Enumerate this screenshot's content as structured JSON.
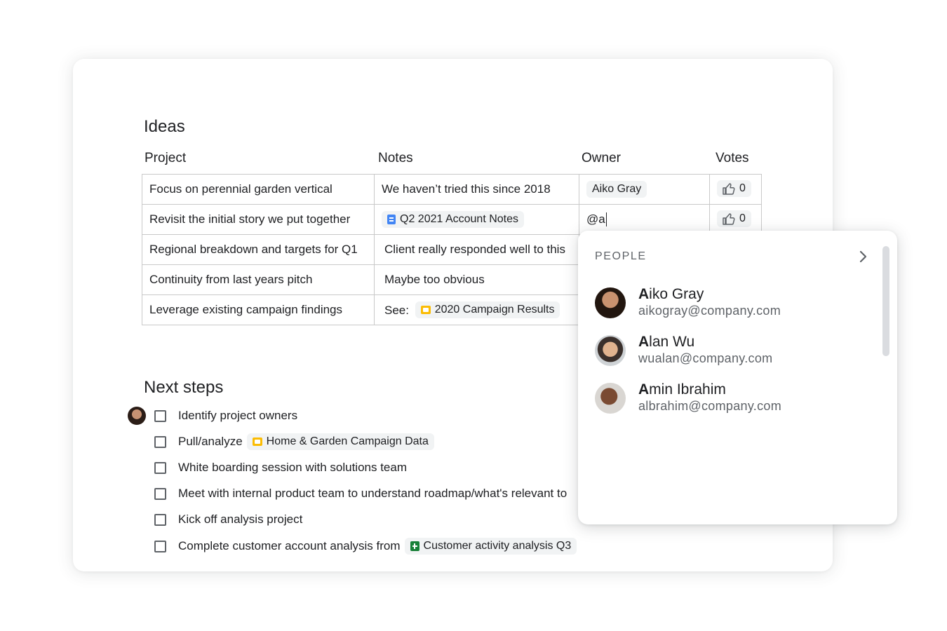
{
  "ideas": {
    "title": "Ideas",
    "columns": [
      "Project",
      "Notes",
      "Owner",
      "Votes"
    ],
    "rows": [
      {
        "project": "Focus on perennial garden vertical",
        "notes": "We haven’t tried this since 2018",
        "owner": "Aiko Gray",
        "votes": "0"
      },
      {
        "project": "Revisit the initial story we put together",
        "notes_chip": "Q2 2021 Account Notes",
        "owner_input": "@a",
        "votes": "0"
      },
      {
        "project": "Regional breakdown and targets for Q1",
        "notes": "Client really responded well to this"
      },
      {
        "project": "Continuity from last years pitch",
        "notes": "Maybe too obvious"
      },
      {
        "project": "Leverage existing campaign findings",
        "notes_prefix": "See:",
        "notes_chip": "2020 Campaign Results"
      }
    ]
  },
  "next_steps": {
    "title": "Next steps",
    "items": [
      {
        "label": "Identify project owners"
      },
      {
        "label": "Pull/analyze",
        "chip": "Home & Garden Campaign Data"
      },
      {
        "label": "White boarding session with solutions team"
      },
      {
        "label": "Meet with internal product team to understand roadmap/what's relevant to"
      },
      {
        "label": "Kick off analysis project"
      },
      {
        "label": "Complete customer account analysis from",
        "chip": "Customer activity analysis Q3"
      }
    ]
  },
  "people_popup": {
    "heading": "PEOPLE",
    "people": [
      {
        "match": "A",
        "rest": "iko Gray",
        "email": "aikogray@company.com"
      },
      {
        "match": "A",
        "rest": "lan Wu",
        "email": "wualan@company.com"
      },
      {
        "match": "A",
        "rest": "min Ibrahim",
        "email": "albrahim@company.com"
      }
    ]
  },
  "icons": {
    "doc": "google-docs-icon",
    "slides": "google-slides-icon",
    "sheets": "google-sheets-icon",
    "vote": "thumbs-up-icon",
    "chevron": "chevron-right-icon"
  },
  "colors": {
    "docs_blue": "#4285f4",
    "slides_yellow": "#fbbc04",
    "sheets_green": "#188038",
    "chip_bg": "#f1f3f4"
  }
}
